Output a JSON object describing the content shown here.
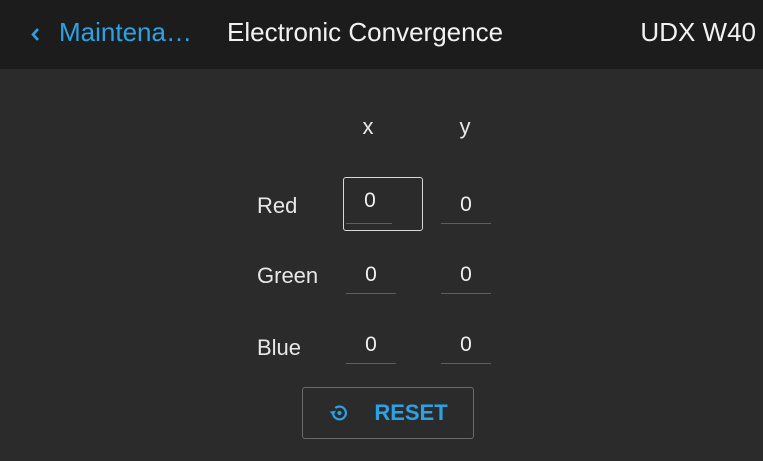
{
  "header": {
    "back_label": "Maintena…",
    "title": "Electronic Convergence",
    "model": "UDX W40"
  },
  "grid": {
    "col_x": "x",
    "col_y": "y",
    "rows": [
      {
        "label": "Red",
        "x": "0",
        "y": "0"
      },
      {
        "label": "Green",
        "x": "0",
        "y": "0"
      },
      {
        "label": "Blue",
        "x": "0",
        "y": "0"
      }
    ]
  },
  "reset_label": "RESET",
  "colors": {
    "accent": "#2aa3e6",
    "background": "#2b2b2b",
    "header": "#1c1c1c"
  },
  "icons": {
    "back": "chevron-left-icon",
    "reset": "reset-icon"
  }
}
